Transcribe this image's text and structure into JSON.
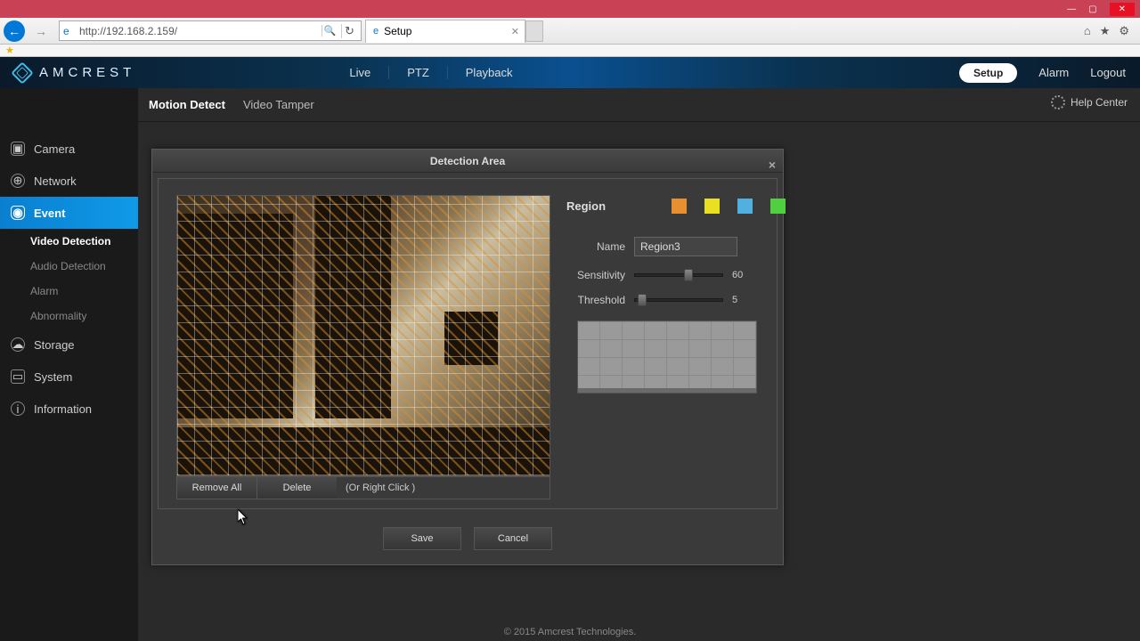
{
  "browser": {
    "url": "http://192.168.2.159/",
    "tab_title": "Setup"
  },
  "brand": "AMCREST",
  "top_nav": {
    "live": "Live",
    "ptz": "PTZ",
    "playback": "Playback",
    "setup": "Setup",
    "alarm": "Alarm",
    "logout": "Logout"
  },
  "sidebar": {
    "camera": "Camera",
    "network": "Network",
    "event": "Event",
    "event_sub": {
      "video_detection": "Video Detection",
      "audio_detection": "Audio Detection",
      "alarm": "Alarm",
      "abnormality": "Abnormality"
    },
    "storage": "Storage",
    "system": "System",
    "information": "Information"
  },
  "content_tabs": {
    "motion_detect": "Motion Detect",
    "video_tamper": "Video Tamper"
  },
  "help_center": "Help Center",
  "modal": {
    "title": "Detection Area",
    "region_label": "Region",
    "name_label": "Name",
    "name_value": "Region3",
    "sensitivity_label": "Sensitivity",
    "sensitivity_value": "60",
    "threshold_label": "Threshold",
    "threshold_value": "5",
    "remove_all": "Remove All",
    "delete": "Delete",
    "right_click_hint": "(Or Right Click )",
    "save": "Save",
    "cancel": "Cancel"
  },
  "footer": "© 2015 Amcrest Technologies."
}
